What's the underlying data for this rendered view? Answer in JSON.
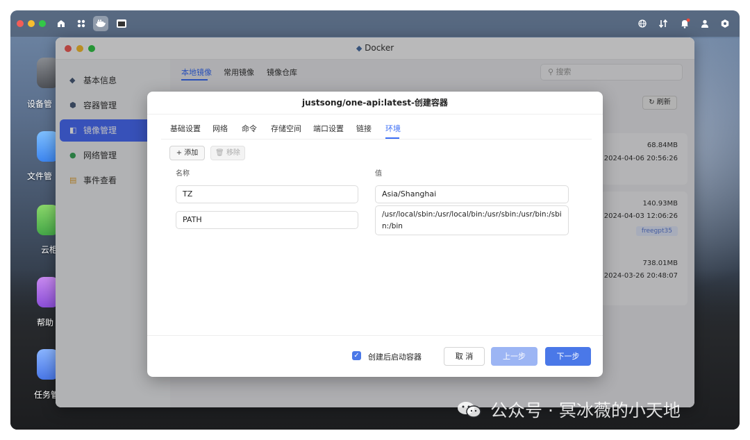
{
  "topbar": {
    "icons": [
      "home-icon",
      "apps-grid-icon",
      "docker-icon",
      "terminal-icon",
      "globe-icon",
      "transfer-icon",
      "bell-icon",
      "user-icon",
      "settings-icon"
    ]
  },
  "desktop": {
    "items": [
      {
        "label": "设备管",
        "icon": "device-icon"
      },
      {
        "label": "文件管",
        "icon": "folder-icon"
      },
      {
        "label": "云柜",
        "icon": "cloud-icon"
      },
      {
        "label": "帮助",
        "icon": "help-icon"
      },
      {
        "label": "任务管",
        "icon": "task-icon"
      }
    ]
  },
  "window": {
    "title": "Docker"
  },
  "sidebar": {
    "items": [
      {
        "label": "基本信息"
      },
      {
        "label": "容器管理"
      },
      {
        "label": "镜像管理"
      },
      {
        "label": "网络管理"
      },
      {
        "label": "事件查看"
      }
    ]
  },
  "main": {
    "tabs": [
      {
        "label": "本地镜像"
      },
      {
        "label": "常用镜像"
      },
      {
        "label": "镜像仓库"
      }
    ],
    "search_placeholder": "搜索",
    "refresh_label": "刷新",
    "cards": [
      {
        "size": "68.84MB",
        "date": "2024-04-06 20:56:26"
      },
      {
        "size": "140.93MB",
        "date": "2024-04-03 12:06:26",
        "tag": "freegpt35"
      },
      {
        "size": "738.01MB",
        "date": "2024-03-26 20:48:07"
      }
    ]
  },
  "modal": {
    "title": "justsong/one-api:latest-创建容器",
    "tabs": [
      {
        "label": "基础设置"
      },
      {
        "label": "网络"
      },
      {
        "label": "命令"
      },
      {
        "label": "存储空间"
      },
      {
        "label": "端口设置"
      },
      {
        "label": "链接"
      },
      {
        "label": "环境"
      }
    ],
    "add_label": "添加",
    "remove_label": "移除",
    "col_name": "名称",
    "col_value": "值",
    "env": [
      {
        "name": "TZ",
        "value": "Asia/Shanghai"
      },
      {
        "name": "PATH",
        "value": "/usr/local/sbin:/usr/local/bin:/usr/sbin:/usr/bin:/sbin:/bin"
      }
    ],
    "start_after_create_label": "创建后启动容器",
    "start_after_create_checked": true,
    "cancel_label": "取 消",
    "prev_label": "上一步",
    "next_label": "下一步"
  },
  "watermark": {
    "text": "公众号 · 冥冰薇的小天地"
  },
  "colors": {
    "accent": "#3b6ef5",
    "sidebar_active": "#4a6cf7",
    "primary_button": "#4a78e8",
    "disabled_button": "#9cb5f4"
  }
}
